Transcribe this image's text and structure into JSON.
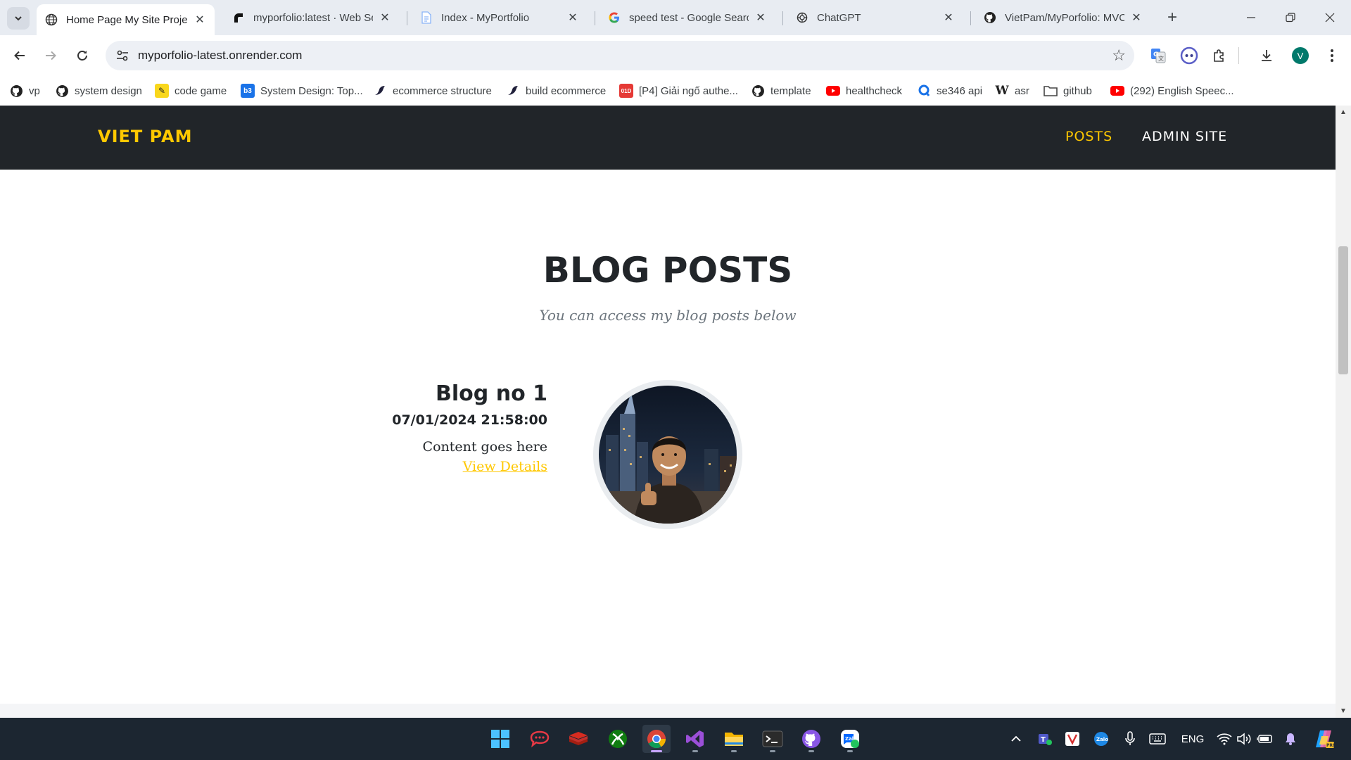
{
  "browser": {
    "tabs": [
      {
        "title": "Home Page My Site Project",
        "active": true,
        "icon": "globe-icon"
      },
      {
        "title": "myporfolio:latest · Web Se",
        "active": false,
        "icon": "render-icon"
      },
      {
        "title": "Index - MyPortfolio",
        "active": false,
        "icon": "document-icon"
      },
      {
        "title": "speed test - Google Search",
        "active": false,
        "icon": "google-icon"
      },
      {
        "title": "ChatGPT",
        "active": false,
        "icon": "chatgpt-icon"
      },
      {
        "title": "VietPam/MyPorfolio: MVC",
        "active": false,
        "icon": "github-icon"
      }
    ],
    "url": "myporfolio-latest.onrender.com",
    "profile_initial": "V",
    "bookmarks": [
      {
        "label": "vp",
        "icon": "github-icon"
      },
      {
        "label": "system design",
        "icon": "github-icon"
      },
      {
        "label": "code game",
        "icon": "pencil-icon"
      },
      {
        "label": "System Design: Top...",
        "icon": "b3-icon"
      },
      {
        "label": "ecommerce structure",
        "icon": "bird-icon"
      },
      {
        "label": "build ecommerce",
        "icon": "bird-icon"
      },
      {
        "label": "[P4] Giải ngố authe...",
        "icon": "p4-icon"
      },
      {
        "label": "template",
        "icon": "github-icon"
      },
      {
        "label": "healthcheck",
        "icon": "youtube-icon"
      },
      {
        "label": "se346 api",
        "icon": "postman-icon"
      },
      {
        "label": "asr",
        "icon": "wikipedia-icon"
      },
      {
        "label": "github",
        "icon": "folder-icon"
      },
      {
        "label": "(292) English Speec...",
        "icon": "youtube-icon"
      }
    ]
  },
  "site": {
    "brand": "VIET PAM",
    "nav": [
      {
        "label": "POSTS",
        "active": true
      },
      {
        "label": "ADMIN SITE",
        "active": false
      }
    ],
    "section_title": "BLOG POSTS",
    "section_subtitle": "You can access my blog posts below",
    "posts": [
      {
        "title": "Blog no 1",
        "date": "07/01/2024 21:58:00",
        "content": "Content goes here",
        "link_label": "View Details"
      }
    ],
    "colors": {
      "accent": "#ffc800",
      "navbar": "#212529"
    }
  },
  "taskbar": {
    "apps": [
      "windows-start-icon",
      "rocketchat-icon",
      "redis-icon",
      "xbox-icon",
      "chrome-icon",
      "visual-studio-icon",
      "file-explorer-icon",
      "terminal-icon",
      "github-desktop-icon",
      "zalo-icon"
    ],
    "language": "ENG"
  }
}
